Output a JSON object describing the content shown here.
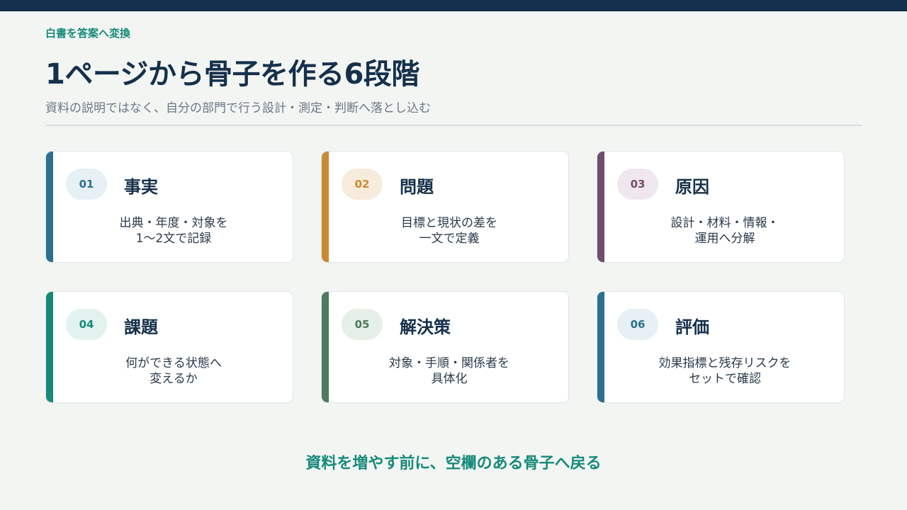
{
  "header": {
    "kicker": "白書を答案へ変換",
    "title": "1ページから骨子を作る6段階",
    "subtitle": "資料の説明ではなく、自分の部門で行う設計・測定・判断へ落とし込む"
  },
  "colors": {
    "navy": "#12304b",
    "teal": "#168a7a",
    "blue": "#2e6f8e",
    "orange": "#c98a35",
    "purple": "#6e4e6a",
    "green": "#4f7a5c"
  },
  "steps": [
    {
      "number": "01",
      "title": "事実",
      "line1": "出典・年度・対象を",
      "line2": "1〜2文で記録"
    },
    {
      "number": "02",
      "title": "問題",
      "line1": "目標と現状の差を",
      "line2": "一文で定義"
    },
    {
      "number": "03",
      "title": "原因",
      "line1": "設計・材料・情報・",
      "line2": "運用へ分解"
    },
    {
      "number": "04",
      "title": "課題",
      "line1": "何ができる状態へ",
      "line2": "変えるか"
    },
    {
      "number": "05",
      "title": "解決策",
      "line1": "対象・手順・関係者を",
      "line2": "具体化"
    },
    {
      "number": "06",
      "title": "評価",
      "line1": "効果指標と残存リスクを",
      "line2": "セットで確認"
    }
  ],
  "footer": "資料を増やす前に、空欄のある骨子へ戻る"
}
